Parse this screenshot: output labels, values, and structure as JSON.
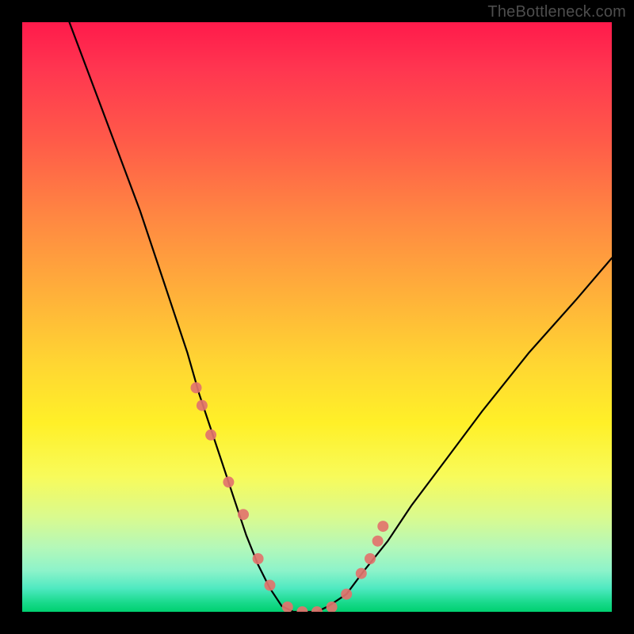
{
  "watermark": "TheBottleneck.com",
  "chart_data": {
    "type": "line",
    "title": "",
    "xlabel": "",
    "ylabel": "",
    "xlim": [
      0,
      100
    ],
    "ylim": [
      0,
      100
    ],
    "grid": false,
    "annotations": [],
    "series": [
      {
        "name": "bottleneck-curve",
        "x": [
          8,
          14,
          20,
          24,
          28,
          30,
          32,
          34,
          36,
          38,
          40,
          42,
          44,
          46,
          48,
          50,
          52,
          55,
          58,
          62,
          66,
          72,
          78,
          86,
          94,
          100
        ],
        "values": [
          100,
          84,
          68,
          56,
          44,
          37,
          31,
          25,
          19,
          13,
          8,
          4,
          1,
          0,
          0,
          0,
          1,
          3,
          7,
          12,
          18,
          26,
          34,
          44,
          53,
          60
        ]
      }
    ],
    "markers": {
      "name": "highlighted-points",
      "color": "#e2736d",
      "radius_px": 7,
      "x": [
        29.5,
        30.5,
        32,
        35,
        37.5,
        40,
        42,
        45,
        47.5,
        50,
        52.5,
        55,
        57.5,
        59,
        60.3,
        61.2
      ],
      "values": [
        38,
        35,
        30,
        22,
        16.5,
        9,
        4.5,
        0.8,
        0,
        0,
        0.8,
        3,
        6.5,
        9,
        12,
        14.5
      ]
    },
    "background_gradient": {
      "direction": "vertical",
      "stops": [
        {
          "pct": 0,
          "color": "#ff1a4b"
        },
        {
          "pct": 20,
          "color": "#ff5a49"
        },
        {
          "pct": 46,
          "color": "#ffb03a"
        },
        {
          "pct": 68,
          "color": "#fff028"
        },
        {
          "pct": 89,
          "color": "#b5f8b8"
        },
        {
          "pct": 100,
          "color": "#00d070"
        }
      ]
    }
  }
}
